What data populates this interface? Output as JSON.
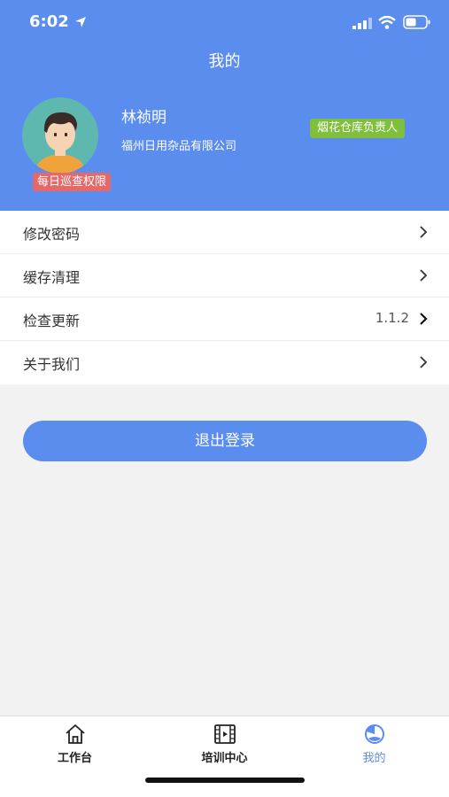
{
  "status_bar": {
    "time": "6:02"
  },
  "header": {
    "title": "我的",
    "user_name": "林祯明",
    "company": "福州日用杂品有限公司",
    "role_badge": "烟花仓库负责人",
    "permission_badge": "每日巡查权限"
  },
  "menu": {
    "items": [
      {
        "label": "修改密码"
      },
      {
        "label": "缓存清理"
      },
      {
        "label": "检查更新",
        "value": "1.1.2"
      },
      {
        "label": "关于我们"
      }
    ]
  },
  "logout_label": "退出登录",
  "tabbar": {
    "tabs": [
      {
        "label": "工作台",
        "icon": "home-icon"
      },
      {
        "label": "培训中心",
        "icon": "video-film-icon"
      },
      {
        "label": "我的",
        "icon": "profile-icon",
        "active": true
      }
    ]
  },
  "colors": {
    "primary": "#5b8def",
    "role_badge": "#7fbf3c",
    "permission_badge": "#e36a6a"
  }
}
